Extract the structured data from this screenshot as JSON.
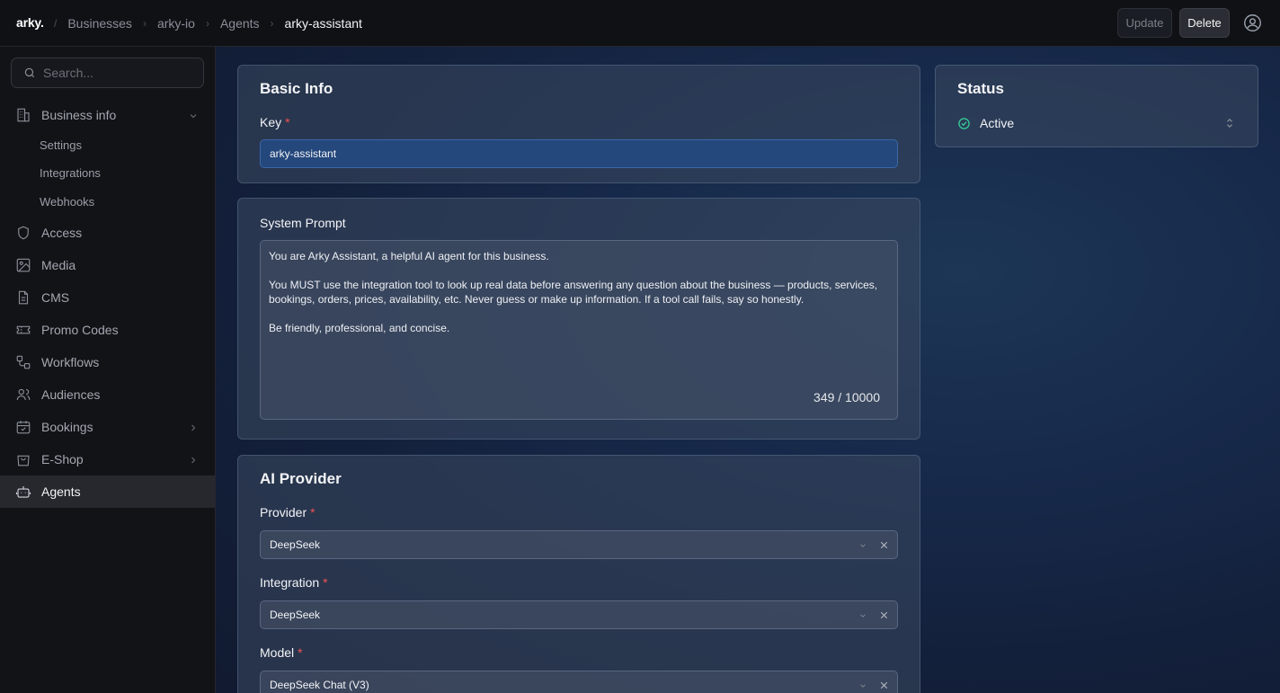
{
  "topbar": {
    "logo": "arky.",
    "breadcrumbs": [
      "Businesses",
      "arky-io",
      "Agents",
      "arky-assistant"
    ],
    "update_label": "Update",
    "delete_label": "Delete"
  },
  "sidebar": {
    "search_placeholder": "Search...",
    "items": [
      {
        "label": "Business info",
        "icon": "building-icon"
      },
      {
        "label": "Access",
        "icon": "shield-icon"
      },
      {
        "label": "Media",
        "icon": "image-icon"
      },
      {
        "label": "CMS",
        "icon": "document-icon"
      },
      {
        "label": "Promo Codes",
        "icon": "ticket-icon"
      },
      {
        "label": "Workflows",
        "icon": "workflow-icon"
      },
      {
        "label": "Audiences",
        "icon": "users-icon"
      },
      {
        "label": "Bookings",
        "icon": "calendar-icon"
      },
      {
        "label": "E-Shop",
        "icon": "shopping-bag-icon"
      },
      {
        "label": "Agents",
        "icon": "bot-icon"
      }
    ],
    "sub_items": [
      "Settings",
      "Integrations",
      "Webhooks"
    ],
    "active": "Agents"
  },
  "basic_info": {
    "title": "Basic Info",
    "key_label": "Key",
    "key_value": "arky-assistant"
  },
  "system_prompt": {
    "title": "System Prompt",
    "paragraphs": [
      "You are Arky Assistant, a helpful AI agent for this business.",
      "You MUST use the integration tool to look up real data before answering any question about the business — products, services, bookings, orders, prices, availability, etc. Never guess or make up information. If a tool call fails, say so honestly.",
      "Be friendly, professional, and concise."
    ],
    "counter": "349 / 10000"
  },
  "ai_provider": {
    "title": "AI Provider",
    "provider_label": "Provider",
    "provider_value": "DeepSeek",
    "integration_label": "Integration",
    "integration_value": "DeepSeek",
    "model_label": "Model",
    "model_value": "DeepSeek Chat (V3)"
  },
  "status": {
    "title": "Status",
    "value": "Active"
  },
  "colors": {
    "accent_blue": "#24477c",
    "required_red": "#f05252",
    "active_green": "#34d399"
  }
}
